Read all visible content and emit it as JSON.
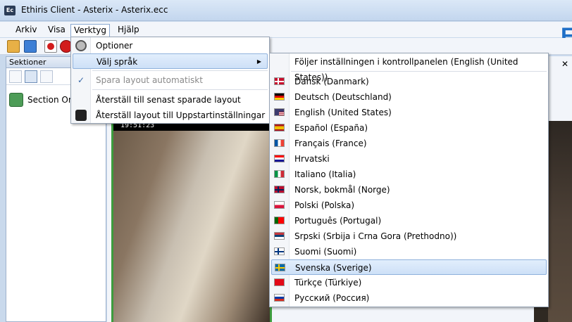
{
  "window": {
    "title": "Ethiris Client - Asterix - Asterix.ecc",
    "app_icon": "Ec"
  },
  "menubar": {
    "items": [
      "Arkiv",
      "Visa",
      "Verktyg",
      "Hjälp"
    ]
  },
  "sidebar": {
    "heading": "Sektioner",
    "section_label": "Section One"
  },
  "video": {
    "timestamp": "19:51:23"
  },
  "tools_menu": {
    "items": [
      {
        "label": "Optioner",
        "icon": "gear-icon"
      },
      {
        "label": "Välj språk",
        "has_submenu": true
      },
      {
        "label": "Spara layout automatiskt",
        "checked": true,
        "disabled": true
      },
      {
        "label": "Återställ till senast sparade layout"
      },
      {
        "label": "Återställ layout till Uppstartinställningar",
        "icon": "reset-icon"
      }
    ]
  },
  "language_menu": {
    "header": "Följer inställningen i kontrollpanelen (English (United States))",
    "selected": "Svenska (Sverige)",
    "languages": [
      {
        "label": "Dansk (Danmark)",
        "flag": "flag-dk"
      },
      {
        "label": "Deutsch (Deutschland)",
        "flag": "flag-de"
      },
      {
        "label": "English (United States)",
        "flag": "flag-us"
      },
      {
        "label": "Español (España)",
        "flag": "flag-es"
      },
      {
        "label": "Français (France)",
        "flag": "flag-fr"
      },
      {
        "label": "Hrvatski",
        "flag": "flag-hr"
      },
      {
        "label": "Italiano (Italia)",
        "flag": "flag-it"
      },
      {
        "label": "Norsk, bokmål (Norge)",
        "flag": "flag-no"
      },
      {
        "label": "Polski (Polska)",
        "flag": "flag-pl"
      },
      {
        "label": "Português (Portugal)",
        "flag": "flag-pt"
      },
      {
        "label": "Srpski (Srbija i Crna Gora (Prethodno))",
        "flag": "flag-rs"
      },
      {
        "label": "Suomi (Suomi)",
        "flag": "flag-fi"
      },
      {
        "label": "Svenska (Sverige)",
        "flag": "flag-se"
      },
      {
        "label": "Türkçe (Türkiye)",
        "flag": "flag-tr"
      },
      {
        "label": "Русский (Россия)",
        "flag": "flag-ru"
      }
    ]
  },
  "colors": {
    "highlight": "#cde0f7",
    "accent": "#1f6fc7",
    "video_border": "#3d9c3d"
  }
}
